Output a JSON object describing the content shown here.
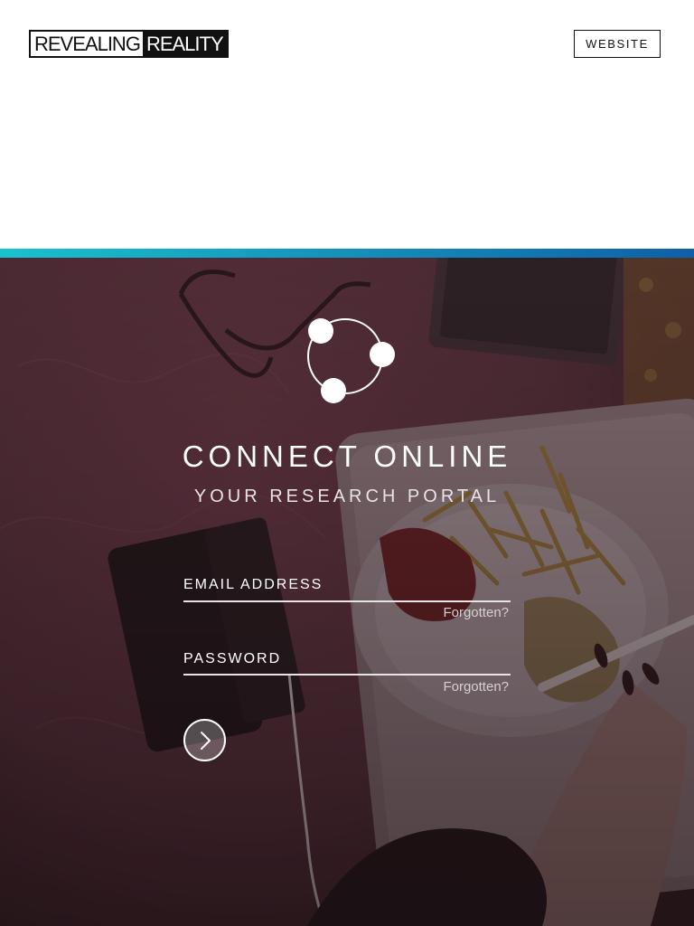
{
  "header": {
    "logo_left": "REVEALING",
    "logo_right": "REALITY",
    "website_label": "WEBSITE"
  },
  "colors": {
    "accent_start": "#19c2cf",
    "accent_end": "#0f5fa8",
    "overlay": "#4a2730"
  },
  "portal": {
    "title": "CONNECT ONLINE",
    "subtitle": "YOUR RESEARCH PORTAL"
  },
  "form": {
    "email_label": "EMAIL ADDRESS",
    "email_forgot": "Forgotten?",
    "password_label": "PASSWORD",
    "password_forgot": "Forgotten?",
    "submit_icon": "chevron-right-icon"
  }
}
